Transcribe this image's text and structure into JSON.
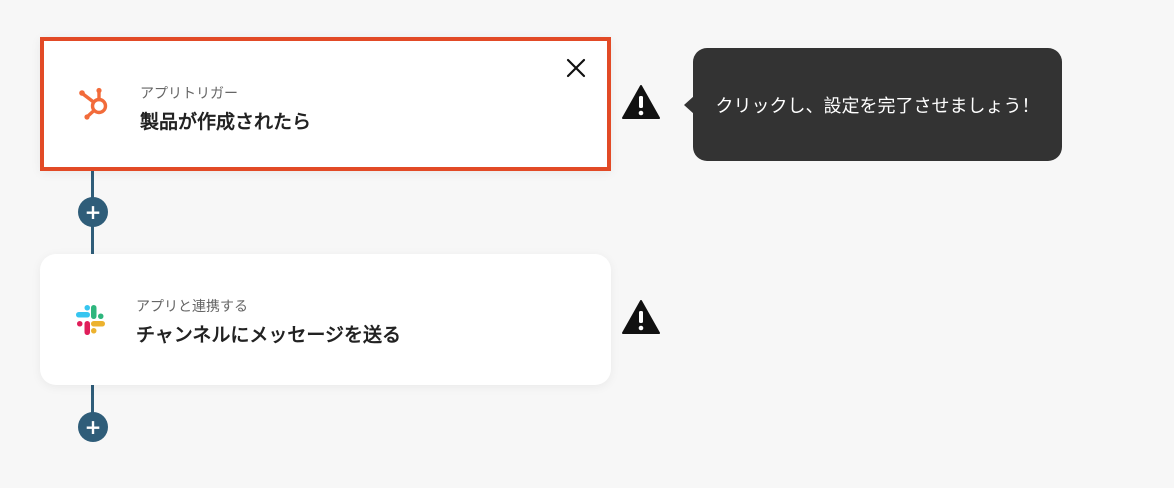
{
  "steps": [
    {
      "subtitle": "アプリトリガー",
      "title": "製品が作成されたら",
      "app_icon": "hubspot-icon",
      "selected": true
    },
    {
      "subtitle": "アプリと連携する",
      "title": "チャンネルにメッセージを送る",
      "app_icon": "slack-icon",
      "selected": false
    }
  ],
  "add_button_label": "+",
  "tooltip": {
    "text": "クリックし、設定を完了させましょう！"
  },
  "colors": {
    "selected_border": "#e24a26",
    "connector": "#2f5d79",
    "tooltip_bg": "#333333",
    "hubspot": "#f26b3a"
  }
}
